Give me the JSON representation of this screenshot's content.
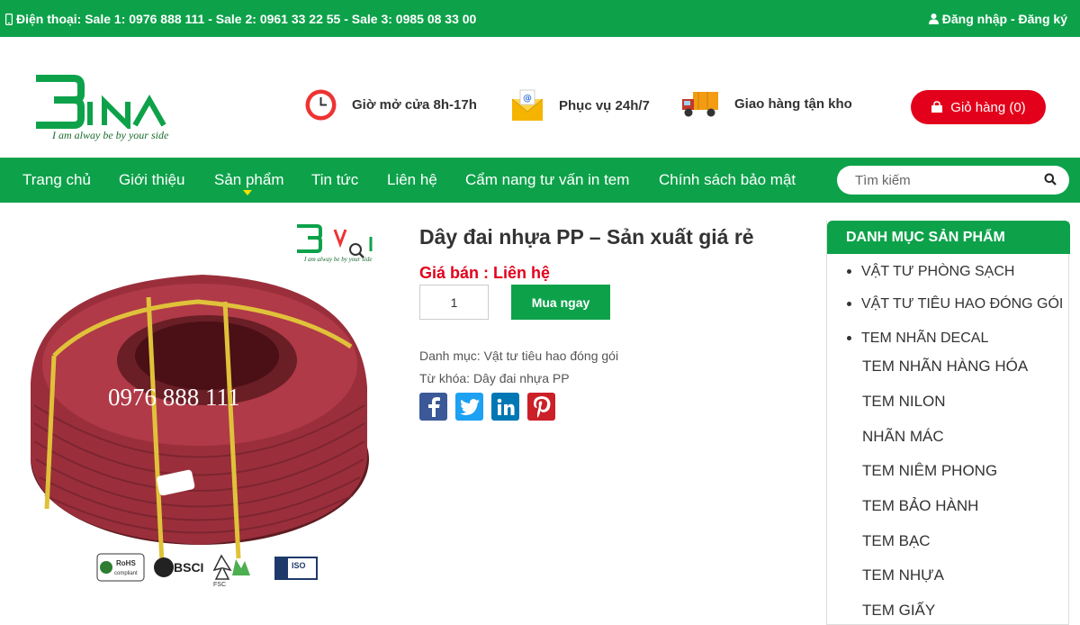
{
  "topbar": {
    "phone_text": "Điện thoại: Sale 1: 0976 888 111 - Sale 2: 0961 33 22 55 - Sale 3: 0985 08 33 00",
    "login_text": "Đăng nhập - Đăng ký"
  },
  "header": {
    "logo_text": "BINA",
    "logo_tagline": "I am alway be by your side",
    "features": [
      {
        "label": "Giờ mở cửa 8h-17h",
        "icon": "clock-icon"
      },
      {
        "label": "Phục vụ 24h/7",
        "icon": "mail-icon"
      },
      {
        "label": "Giao hàng tận kho",
        "icon": "truck-icon"
      }
    ],
    "cart_label": "Giỏ hàng (0)"
  },
  "nav": {
    "items": [
      "Trang chủ",
      "Giới thiệu",
      "Sản phẩm",
      "Tin tức",
      "Liên hệ",
      "Cẩm nang tư vấn in tem",
      "Chính sách bảo mật"
    ],
    "search_placeholder": "Tìm kiếm"
  },
  "product": {
    "image_phone_watermark": "0976 888 111",
    "image_logo_tagline": "I am alway be by your side",
    "cert_labels": [
      "RoHS compliant",
      "BSCI",
      "FSC",
      "ISO"
    ],
    "title": "Dây đai nhựa PP – Sản xuất giá rẻ",
    "price": "Giá bán : Liên hệ",
    "quantity": "1",
    "buy_label": "Mua ngay",
    "category_line": "Danh mục: Vật tư tiêu hao đóng gói",
    "tag_line": "Từ khóa: Dây đai nhựa PP"
  },
  "sidebar": {
    "heading": "DANH MỤC SẢN PHẨM",
    "items": [
      "VẬT TƯ PHÒNG SẠCH",
      "VẬT TƯ TIÊU HAO ĐÓNG GÓI",
      "TEM NHÃN DECAL"
    ],
    "subitems": [
      "TEM NHÃN HÀNG HÓA",
      "TEM NILON",
      "NHÃN MÁC",
      "TEM NIÊM PHONG",
      "TEM BẢO HÀNH",
      "TEM BẠC",
      "TEM NHỰA",
      "TEM GIẤY"
    ]
  },
  "colors": {
    "brand_green": "#0da24a",
    "cart_red": "#e3001b",
    "price_red": "#e3001b"
  }
}
